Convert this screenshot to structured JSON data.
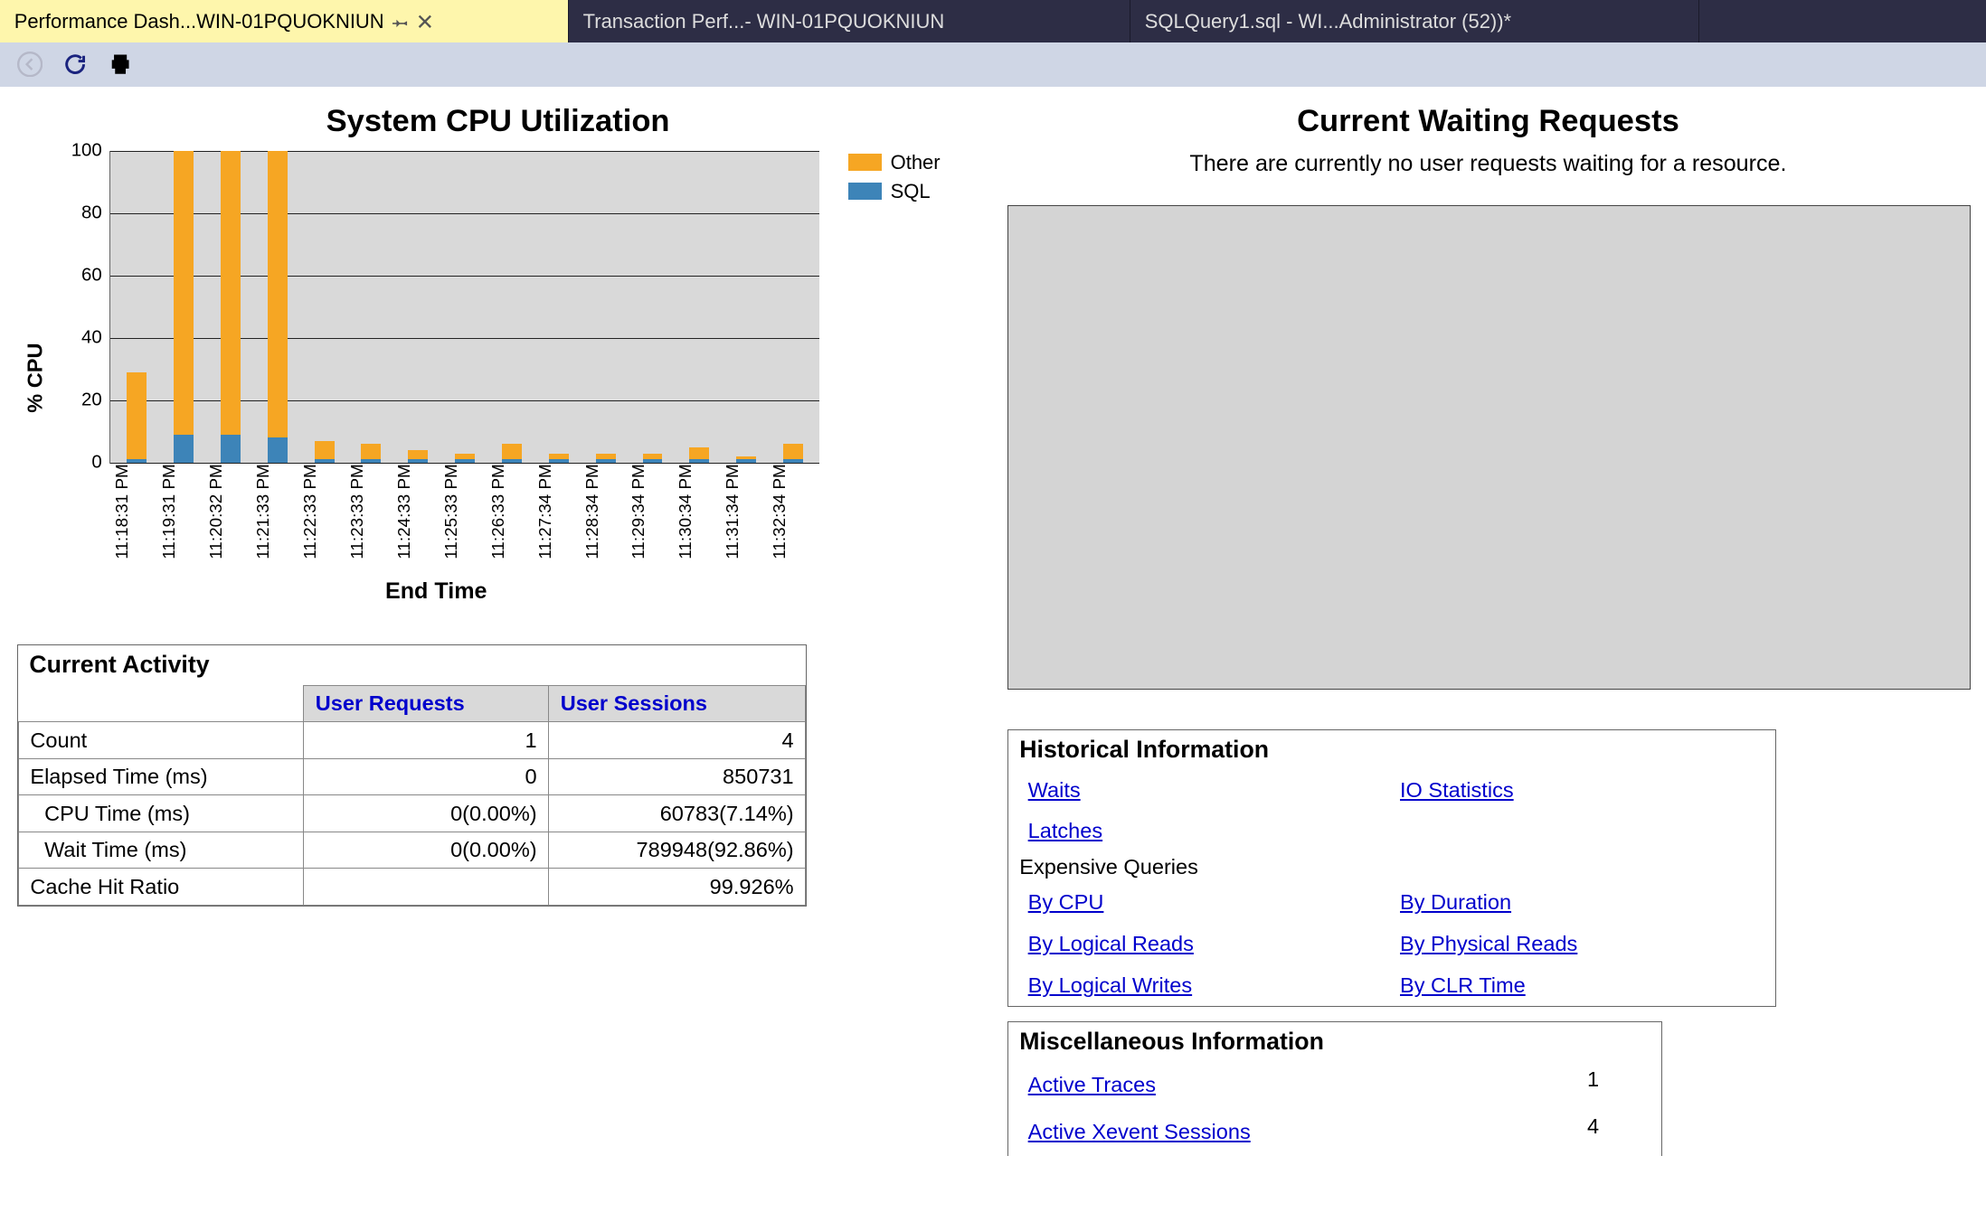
{
  "tabs": [
    {
      "label": "Performance Dash...WIN-01PQUOKNIUN",
      "active": true
    },
    {
      "label": "Transaction Perf...- WIN-01PQUOKNIUN",
      "active": false
    },
    {
      "label": "SQLQuery1.sql - WI...Administrator (52))*",
      "active": false
    }
  ],
  "sections": {
    "cpu_title": "System CPU Utilization",
    "waiting_title": "Current Waiting Requests",
    "waiting_msg": "There are currently no user requests waiting for a resource.",
    "current_activity_title": "Current Activity",
    "historical_title": "Historical Information",
    "expensive_queries": "Expensive Queries",
    "misc_title": "Miscellaneous Information"
  },
  "chart_data": {
    "type": "bar",
    "ylabel": "% CPU",
    "xlabel": "End Time",
    "ylim": [
      0,
      100
    ],
    "yticks": [
      0,
      20,
      40,
      60,
      80,
      100
    ],
    "legend": [
      "Other",
      "SQL"
    ],
    "categories": [
      "11:18:31 PM",
      "11:19:31 PM",
      "11:20:32 PM",
      "11:21:33 PM",
      "11:22:33 PM",
      "11:23:33 PM",
      "11:24:33 PM",
      "11:25:33 PM",
      "11:26:33 PM",
      "11:27:34 PM",
      "11:28:34 PM",
      "11:29:34 PM",
      "11:30:34 PM",
      "11:31:34 PM",
      "11:32:34 PM"
    ],
    "series": [
      {
        "name": "SQL",
        "values": [
          1,
          9,
          9,
          8,
          1,
          1,
          1,
          1,
          1,
          1,
          1,
          1,
          1,
          1,
          1
        ]
      },
      {
        "name": "Other",
        "values": [
          28,
          91,
          91,
          92,
          6,
          5,
          3,
          2,
          5,
          2,
          2,
          2,
          4,
          1,
          5
        ]
      }
    ]
  },
  "activity": {
    "headers": {
      "requests": "User Requests",
      "sessions": "User Sessions"
    },
    "rows": [
      {
        "label": "Count",
        "req": "1",
        "sess": "4"
      },
      {
        "label": "Elapsed Time (ms)",
        "req": "0",
        "sess": "850731"
      },
      {
        "label": "CPU Time (ms)",
        "req": "0(0.00%)",
        "sess": "60783(7.14%)",
        "indent": true
      },
      {
        "label": "Wait Time (ms)",
        "req": "0(0.00%)",
        "sess": "789948(92.86%)",
        "indent": true
      },
      {
        "label": "Cache Hit Ratio",
        "req": "",
        "sess": "99.926%"
      }
    ]
  },
  "historical": {
    "row1": {
      "a": "Waits",
      "b": "IO Statistics"
    },
    "row2": {
      "a": "Latches",
      "b": ""
    },
    "exp": {
      "r1": {
        "a": "By CPU",
        "b": "By Duration"
      },
      "r2": {
        "a": "By Logical Reads",
        "b": "By Physical Reads"
      },
      "r3": {
        "a": "By Logical Writes",
        "b": "By CLR Time"
      }
    }
  },
  "misc": {
    "r1": {
      "label": "Active Traces",
      "val": "1"
    },
    "r2": {
      "label": "Active Xevent Sessions",
      "val": "4"
    }
  }
}
